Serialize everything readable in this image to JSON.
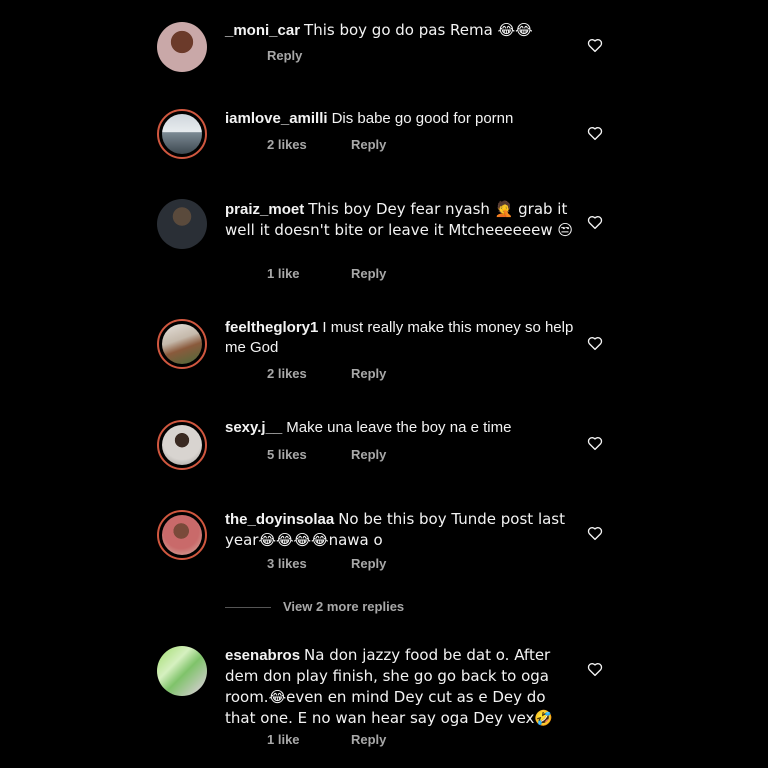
{
  "comments": [
    {
      "username": "_moni_car",
      "text": "This boy go do pas Rema 😂😂",
      "likes": "",
      "reply": "Reply"
    },
    {
      "username": "iamlove_amilli",
      "text": "Dis babe go good for pornn",
      "likes": "2 likes",
      "reply": "Reply"
    },
    {
      "username": "praiz_moet",
      "text": "This boy Dey fear nyash 🤦 grab it well it doesn't bite or leave it Mtcheeeeeew 😒",
      "likes": "1 like",
      "reply": "Reply"
    },
    {
      "username": "feeltheglory1",
      "text": "I must really make this money so help me God",
      "likes": "2 likes",
      "reply": "Reply"
    },
    {
      "username": "sexy.j__",
      "text": "Make una leave the boy na e time",
      "likes": "5 likes",
      "reply": "Reply"
    },
    {
      "username": "the_doyinsolaa",
      "text": "No be this boy Tunde post last year😂😂😂😂nawa o",
      "likes": "3 likes",
      "reply": "Reply"
    },
    {
      "username": "esenabros",
      "text": "Na don jazzy food be dat o. After dem don play finish, she go go back to oga room.😂even en mind Dey cut as e Dey do that one. E no wan hear say oga Dey vex🤣",
      "likes": "1 like",
      "reply": "Reply"
    }
  ],
  "view_replies": "View 2 more replies",
  "icons": {
    "like": "heart-outline-icon"
  },
  "colors": {
    "background": "#000000",
    "text": "#f3f3f3",
    "meta": "#a8a8a8",
    "story_ring": "#d0573f"
  }
}
